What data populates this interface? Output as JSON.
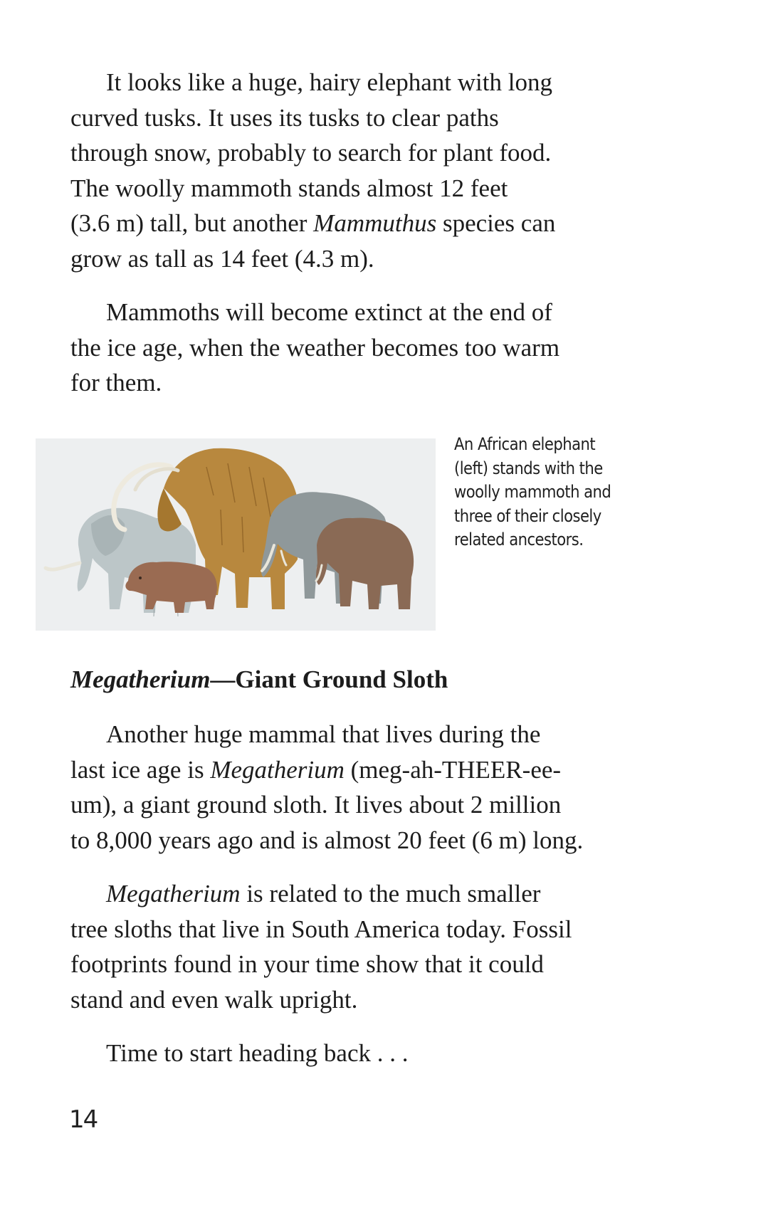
{
  "paragraphs": {
    "p1": {
      "line1": "It looks like a huge, hairy elephant with long",
      "line2": "curved tusks. It uses its tusks to clear paths",
      "line3": "through snow, probably to search for plant food.",
      "line4": "The woolly mammoth stands almost 12 feet",
      "line5a": "(3.6 m) tall, but another ",
      "line5_italic": "Mammuthus",
      "line5b": " species can",
      "line6": "grow as tall as 14 feet (4.3 m)."
    },
    "p2": {
      "line1": "Mammoths will become extinct at the end of",
      "line2": "the ice age, when the weather becomes too warm",
      "line3": "for them."
    },
    "p3": {
      "line1": "Another huge mammal that lives during the",
      "line2a": "last ice age is ",
      "line2_italic": "Megatherium",
      "line2b": " (meg-ah-THEER-ee-",
      "line3": "um), a giant ground sloth. It lives about 2 million",
      "line4": "to 8,000 years ago and is almost 20 feet (6 m) long."
    },
    "p4": {
      "line1_italic": "Megatherium",
      "line1b": " is related to the much smaller",
      "line2": "tree sloths that live in South America today. Fossil",
      "line3": "footprints found in your time show that it could",
      "line4": "stand and even walk upright."
    },
    "p5": {
      "line1": "Time to start heading back . . ."
    }
  },
  "heading": {
    "italic": "Megatherium",
    "rest": "—Giant Ground Sloth"
  },
  "figure": {
    "caption": {
      "line1": "An African elephant",
      "line2": "(left) stands with the",
      "line3": "woolly mammoth and",
      "line4": "three of their closely",
      "line5": "related ancestors."
    },
    "animals": [
      "african-elephant",
      "woolly-mammoth",
      "ancestor-small",
      "ancestor-gray",
      "ancestor-brown"
    ],
    "colors": {
      "background": "#edeff0",
      "elephant": "#b9c4c6",
      "mammoth": "#b8883e",
      "gray_ancestor": "#8f989a",
      "brown_ancestor": "#8a6a55",
      "small_ancestor": "#9a6b52",
      "tusk": "#eeeade"
    }
  },
  "page_number": "14"
}
